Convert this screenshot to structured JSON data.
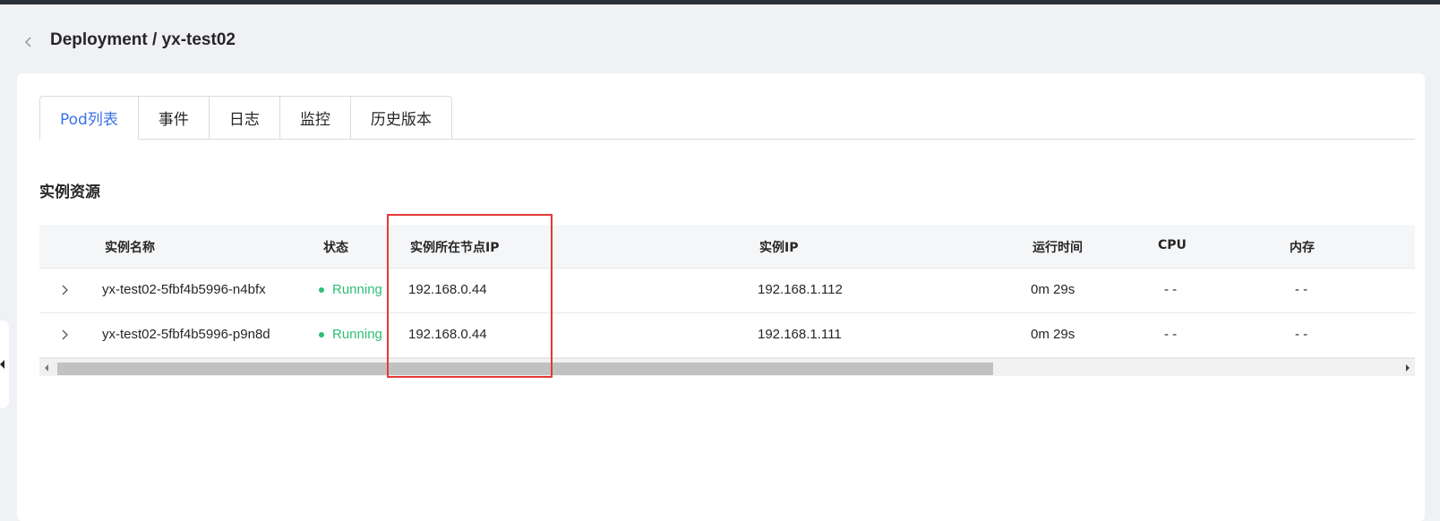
{
  "header": {
    "title": "Deployment / yx-test02"
  },
  "tabs": [
    {
      "label": "Pod列表",
      "active": true
    },
    {
      "label": "事件",
      "active": false
    },
    {
      "label": "日志",
      "active": false
    },
    {
      "label": "监控",
      "active": false
    },
    {
      "label": "历史版本",
      "active": false
    }
  ],
  "section": {
    "title": "实例资源"
  },
  "table": {
    "columns": [
      "实例名称",
      "状态",
      "实例所在节点IP",
      "实例IP",
      "运行时间",
      "CPU",
      "内存"
    ],
    "rows": [
      {
        "name": "yx-test02-5fbf4b5996-n4bfx",
        "status": "Running",
        "node_ip": "192.168.0.44",
        "pod_ip": "192.168.1.112",
        "uptime": "0m 29s",
        "cpu": "- -",
        "memory": "- -"
      },
      {
        "name": "yx-test02-5fbf4b5996-p9n8d",
        "status": "Running",
        "node_ip": "192.168.0.44",
        "pod_ip": "192.168.1.111",
        "uptime": "0m 29s",
        "cpu": "- -",
        "memory": "- -"
      }
    ]
  },
  "icons": {
    "back": "chevron-left-icon",
    "expand": "chevron-right-icon",
    "status": "status-dot-icon"
  },
  "colors": {
    "accent": "#3a72e6",
    "running": "#2dbe76",
    "highlight": "#e53935"
  }
}
